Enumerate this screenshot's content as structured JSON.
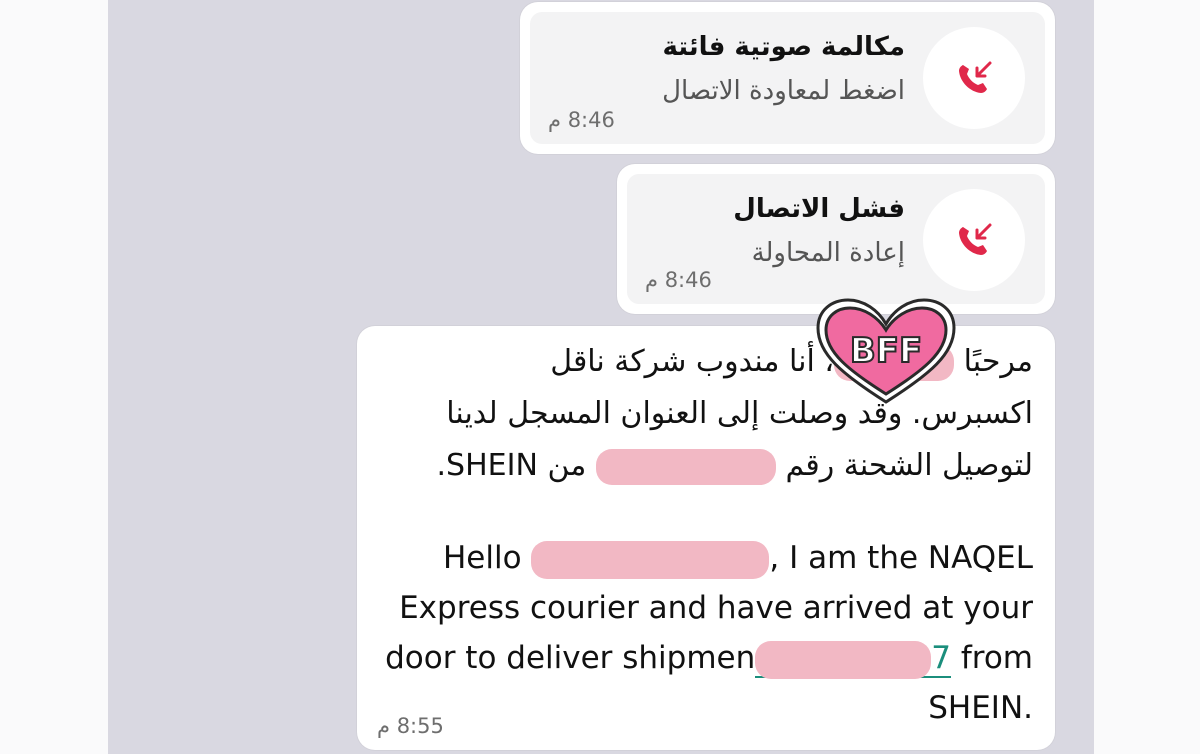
{
  "call_missed": {
    "title": "مكالمة صوتية فائتة",
    "subtitle": "اضغط لمعاودة الاتصال",
    "time": "8:46 م",
    "icon": "missed-call-icon"
  },
  "call_failed": {
    "title": "فشل الاتصال",
    "subtitle": "إعادة المحاولة",
    "time": "8:46 م",
    "icon": "missed-call-icon"
  },
  "message": {
    "ar_line1_start": "مرحبًا",
    "ar_line1_end": "، أنا مندوب شركة ناقل",
    "ar_line2": "اكسبرس. وقد وصلت إلى العنوان المسجل لدينا",
    "ar_line3_start": "لتوصيل الشحنة رقم",
    "ar_line3_end": "من SHEIN.",
    "en_line1_start": "Hello",
    "en_line1_end": ", I am the NAQEL",
    "en_line2": "Express courier and have arrived at your",
    "en_line3_start": "door to deliver shipmen",
    "en_line3_link_end": "7",
    "en_line3_end": " from",
    "en_line4": "SHEIN.",
    "time": "8:55 م"
  },
  "sticker": {
    "text": "BFF",
    "color": "#f06aa0"
  },
  "colors": {
    "missed_call_red": "#e0284a",
    "link_green": "#1b8e7c",
    "redaction_pink": "#f2b8c4"
  }
}
